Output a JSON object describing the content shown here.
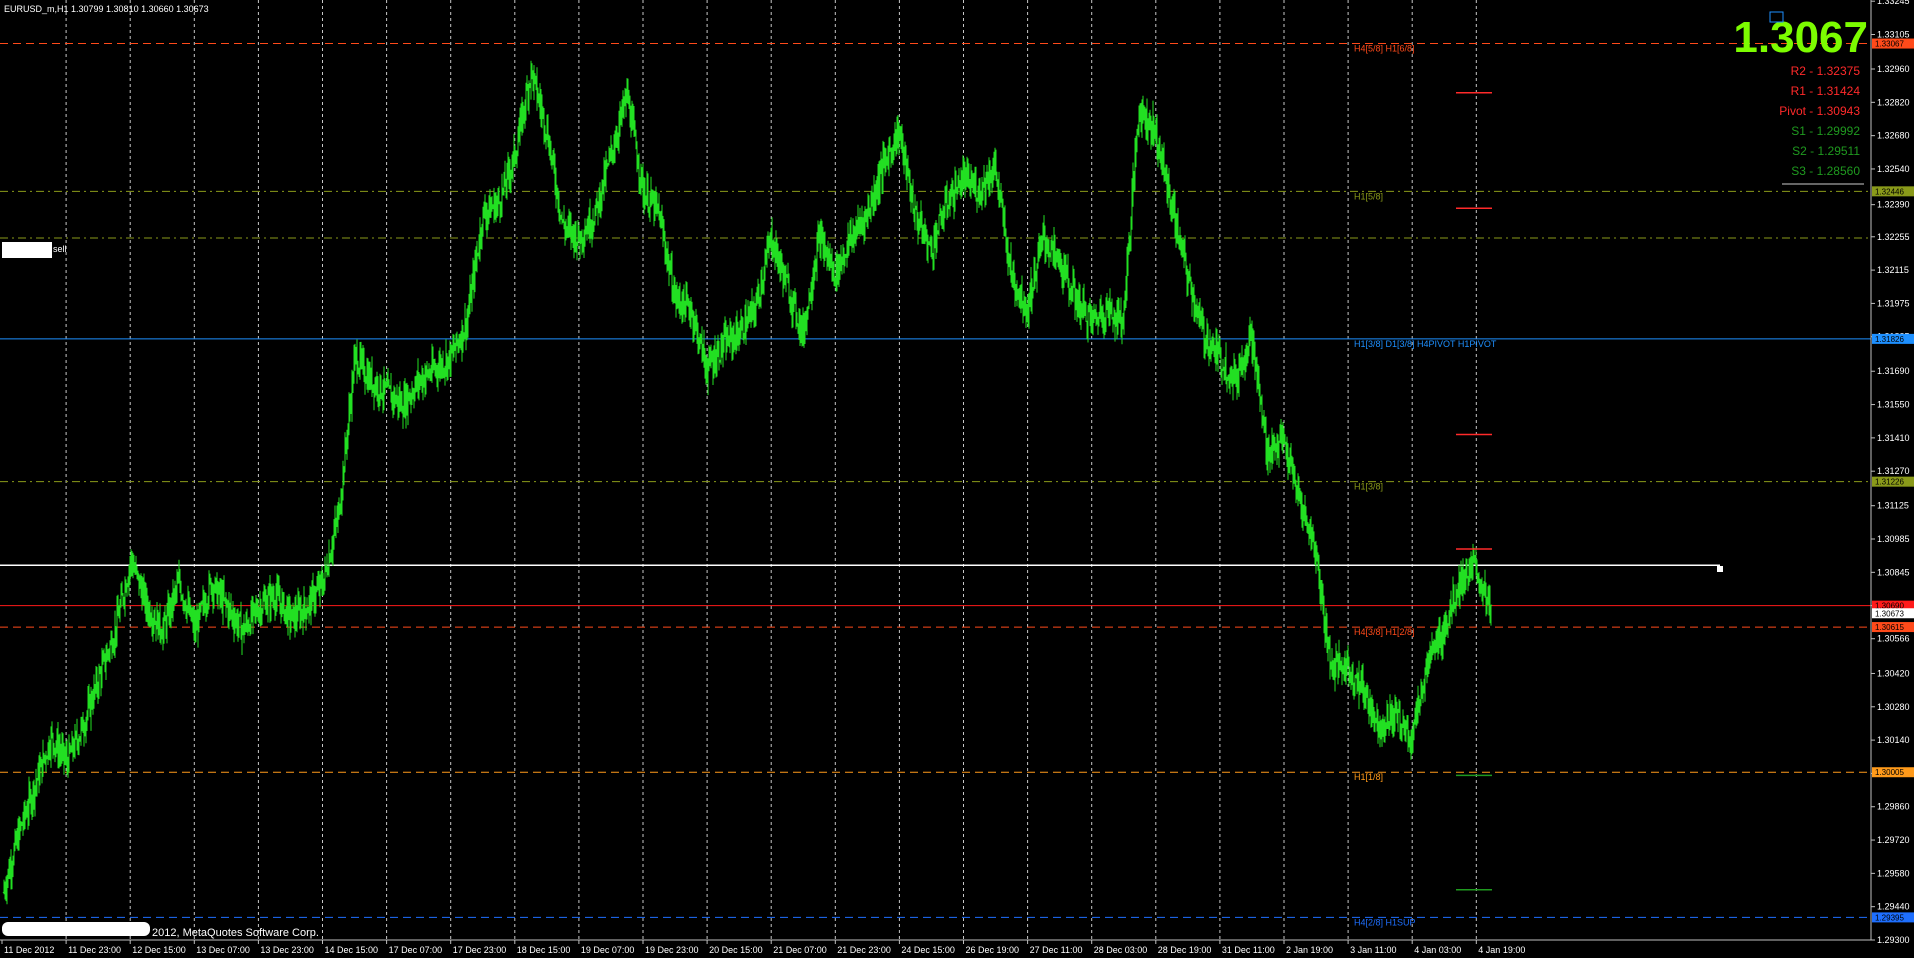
{
  "window": {
    "symbol_header": "EURUSD_m,H1  1.30799 1.30810 1.30660 1.30673",
    "copyright": "2012, MetaQuotes Software Corp.",
    "sell_label": "sell"
  },
  "big_price": "1.3067",
  "pivot_panel": [
    {
      "label": "R2 - 1.32375",
      "color": "#ff2a2a"
    },
    {
      "label": "R1 - 1.31424",
      "color": "#ff2a2a"
    },
    {
      "label": "Pivot - 1.30943",
      "color": "#ff2a2a"
    },
    {
      "label": "S1 - 1.29992",
      "color": "#1f9a1f"
    },
    {
      "label": "S2 - 1.29511",
      "color": "#1f9a1f"
    },
    {
      "label": "S3 - 1.28560",
      "color": "#1f9a1f"
    }
  ],
  "chart_data": {
    "type": "candlestick",
    "symbol": "EURUSD_m",
    "timeframe": "H1",
    "ylim": [
      1.293,
      1.3325
    ],
    "y_ticks": [
      "1.33245",
      "1.33105",
      "1.32960",
      "1.32820",
      "1.32680",
      "1.32540",
      "1.32390",
      "1.32255",
      "1.32115",
      "1.31975",
      "1.31835",
      "1.31690",
      "1.31550",
      "1.31410",
      "1.31270",
      "1.31125",
      "1.30985",
      "1.30845",
      "1.30705",
      "1.30566",
      "1.30420",
      "1.30280",
      "1.30140",
      "1.30000",
      "1.29860",
      "1.29720",
      "1.29580",
      "1.29440",
      "1.29300"
    ],
    "x_ticks": [
      "11 Dec 2012",
      "11 Dec 23:00",
      "12 Dec 15:00",
      "13 Dec 07:00",
      "13 Dec 23:00",
      "14 Dec 15:00",
      "17 Dec 07:00",
      "17 Dec 23:00",
      "18 Dec 15:00",
      "19 Dec 07:00",
      "19 Dec 23:00",
      "20 Dec 15:00",
      "21 Dec 07:00",
      "21 Dec 23:00",
      "24 Dec 15:00",
      "26 Dec 19:00",
      "27 Dec 11:00",
      "28 Dec 03:00",
      "28 Dec 19:00",
      "31 Dec 11:00",
      "2 Jan 19:00",
      "3 Jan 11:00",
      "4 Jan 03:00",
      "4 Jan 19:00"
    ],
    "price_path": [
      1.295,
      1.2975,
      1.2995,
      1.3015,
      1.3005,
      1.302,
      1.304,
      1.306,
      1.309,
      1.307,
      1.306,
      1.308,
      1.306,
      1.308,
      1.307,
      1.306,
      1.307,
      1.3075,
      1.3065,
      1.307,
      1.308,
      1.311,
      1.3175,
      1.3165,
      1.316,
      1.3155,
      1.3165,
      1.317,
      1.3175,
      1.319,
      1.3235,
      1.324,
      1.326,
      1.3295,
      1.327,
      1.323,
      1.3225,
      1.3235,
      1.326,
      1.3285,
      1.3245,
      1.3235,
      1.32,
      1.3195,
      1.317,
      1.318,
      1.3185,
      1.3195,
      1.3225,
      1.3205,
      1.3185,
      1.3225,
      1.321,
      1.3225,
      1.3235,
      1.3255,
      1.327,
      1.3235,
      1.322,
      1.324,
      1.325,
      1.3245,
      1.3255,
      1.321,
      1.3195,
      1.3225,
      1.3215,
      1.32,
      1.319,
      1.3195,
      1.319,
      1.328,
      1.327,
      1.324,
      1.321,
      1.3185,
      1.3175,
      1.3165,
      1.3185,
      1.3135,
      1.314,
      1.3115,
      1.3095,
      1.3045,
      1.3045,
      1.3035,
      1.302,
      1.3025,
      1.3015,
      1.3045,
      1.306,
      1.308,
      1.3087,
      1.3067
    ],
    "current_price": 1.30673,
    "horizontal_lines": [
      {
        "price": 1.33067,
        "color": "#ff4a1a",
        "dash": "8,5",
        "label": "H4[5/8] H1[6/8]",
        "tag": "1.33067"
      },
      {
        "price": 1.32446,
        "color": "#8a9a1a",
        "dash": "8,4,2,4",
        "label": "H1[5/8]",
        "tag": "1.32446"
      },
      {
        "price": 1.3225,
        "color": "#8a9a1a",
        "dash": "8,4,2,4",
        "label": "",
        "tag": ""
      },
      {
        "price": 1.31826,
        "color": "#1e90ff",
        "dash": "",
        "label": "H1[3/8] D1[3/8] H4PIVOT H1PIVOT",
        "tag": "1.31826"
      },
      {
        "price": 1.31226,
        "color": "#8a9a1a",
        "dash": "8,4,2,4",
        "label": "H1[3/8]",
        "tag": "1.31226"
      },
      {
        "price": 1.30875,
        "color": "#ffffff",
        "dash": "",
        "label": "",
        "tag": ""
      },
      {
        "price": 1.30705,
        "color": "#ff1a1a",
        "dash": "",
        "label": "",
        "tag": "1.30690"
      },
      {
        "price": 1.30615,
        "color": "#ff4a1a",
        "dash": "8,5",
        "label": "H4[3/8] H1[2/8]",
        "tag": "1.30615"
      },
      {
        "price": 1.30005,
        "color": "#ff9a1a",
        "dash": "8,5",
        "label": "H1[1/8]",
        "tag": "1.30005"
      },
      {
        "price": 1.29395,
        "color": "#1e6fff",
        "dash": "8,5",
        "label": "H4[2/8] H1SUP",
        "tag": "1.29395"
      }
    ],
    "pivot_marks": [
      {
        "price": 1.3286,
        "color": "#ff2a2a"
      },
      {
        "price": 1.32375,
        "color": "#ff2a2a"
      },
      {
        "price": 1.31424,
        "color": "#ff2a2a"
      },
      {
        "price": 1.30943,
        "color": "#ff2a2a"
      },
      {
        "price": 1.29992,
        "color": "#1f9a1f"
      },
      {
        "price": 1.29511,
        "color": "#1f9a1f"
      }
    ]
  }
}
